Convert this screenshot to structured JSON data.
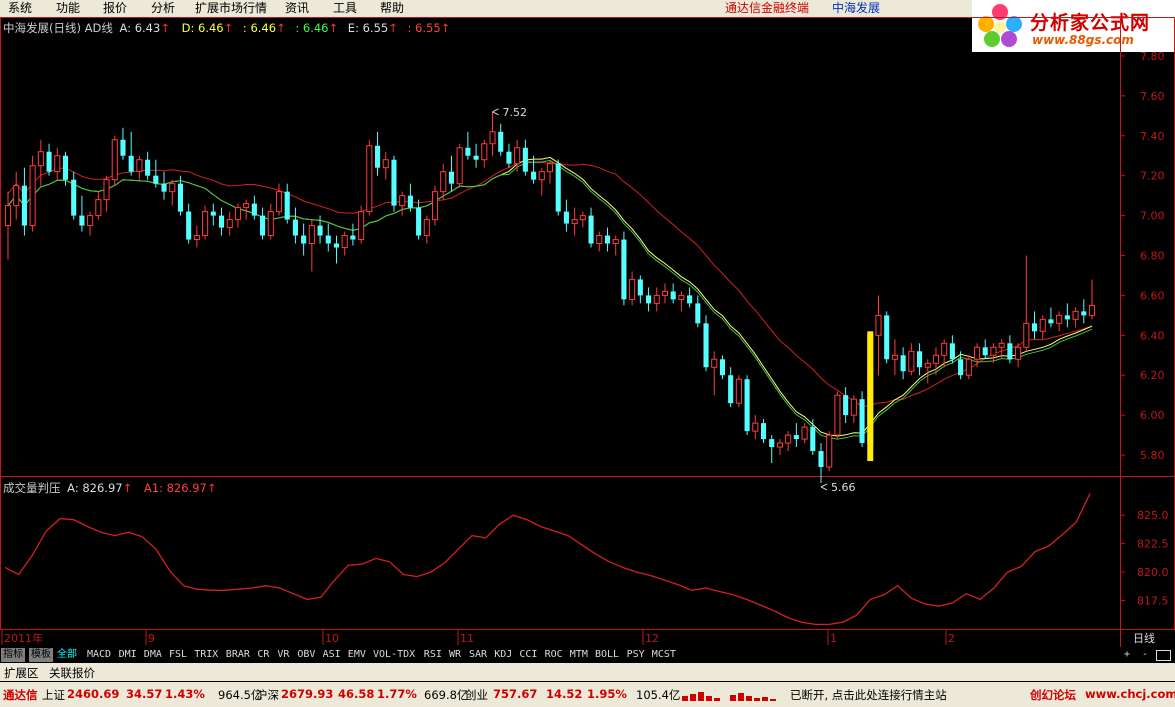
{
  "menu": [
    "系统",
    "功能",
    "报价",
    "分析",
    "扩展市场行情",
    "资讯",
    "工具",
    "帮助"
  ],
  "promo": "通达信金融终端",
  "stock_name": "中海发展",
  "logo": {
    "title": "分析家公式网",
    "url": "www.88gs.com"
  },
  "price_header": {
    "prefix": "中海发展(日线) AD线",
    "a": "A: 6.43",
    "d": "D: 6.46",
    "v3": ": 6.46",
    "v4": ": 6.46",
    "e": "E: 6.55",
    "v6": ": 6.55"
  },
  "ind_header": {
    "name": "成交量判压",
    "a": "A: 826.97",
    "a1": "A1: 826.97"
  },
  "chart_data": [
    {
      "type": "candlestick",
      "ylim": [
        5.7,
        7.9
      ],
      "yticks": [
        "7.80",
        "7.60",
        "7.40",
        "7.20",
        "7.00",
        "6.80",
        "6.60",
        "6.40",
        "6.20",
        "6.00",
        "5.80"
      ],
      "annotations": [
        "7.52",
        "5.66"
      ],
      "ohlc": [
        [
          6.95,
          7.12,
          6.78,
          7.05
        ],
        [
          7.05,
          7.22,
          6.98,
          7.15
        ],
        [
          7.15,
          7.24,
          6.9,
          6.95
        ],
        [
          6.95,
          7.3,
          6.92,
          7.25
        ],
        [
          7.25,
          7.38,
          7.15,
          7.32
        ],
        [
          7.32,
          7.36,
          7.2,
          7.22
        ],
        [
          7.22,
          7.34,
          7.18,
          7.3
        ],
        [
          7.3,
          7.32,
          7.15,
          7.18
        ],
        [
          7.18,
          7.22,
          6.98,
          7.0
        ],
        [
          7.0,
          7.1,
          6.92,
          6.95
        ],
        [
          6.95,
          7.02,
          6.9,
          7.0
        ],
        [
          7.0,
          7.12,
          6.98,
          7.08
        ],
        [
          7.08,
          7.2,
          7.02,
          7.18
        ],
        [
          7.18,
          7.4,
          7.15,
          7.38
        ],
        [
          7.38,
          7.44,
          7.28,
          7.3
        ],
        [
          7.3,
          7.42,
          7.2,
          7.22
        ],
        [
          7.22,
          7.3,
          7.18,
          7.28
        ],
        [
          7.28,
          7.32,
          7.18,
          7.2
        ],
        [
          7.2,
          7.28,
          7.14,
          7.16
        ],
        [
          7.16,
          7.22,
          7.08,
          7.12
        ],
        [
          7.12,
          7.18,
          7.05,
          7.16
        ],
        [
          7.16,
          7.2,
          7.0,
          7.02
        ],
        [
          7.02,
          7.06,
          6.86,
          6.88
        ],
        [
          6.88,
          6.95,
          6.84,
          6.9
        ],
        [
          6.9,
          7.05,
          6.88,
          7.02
        ],
        [
          7.02,
          7.06,
          6.95,
          7.0
        ],
        [
          7.0,
          7.04,
          6.9,
          6.94
        ],
        [
          6.94,
          7.02,
          6.9,
          6.98
        ],
        [
          6.98,
          7.06,
          6.94,
          7.04
        ],
        [
          7.04,
          7.08,
          6.98,
          7.06
        ],
        [
          7.06,
          7.1,
          6.98,
          7.0
        ],
        [
          7.0,
          7.04,
          6.88,
          6.9
        ],
        [
          6.9,
          7.06,
          6.88,
          7.02
        ],
        [
          7.02,
          7.16,
          7.0,
          7.12
        ],
        [
          7.12,
          7.16,
          6.96,
          6.98
        ],
        [
          6.98,
          7.04,
          6.86,
          6.9
        ],
        [
          6.9,
          6.96,
          6.8,
          6.86
        ],
        [
          6.86,
          6.98,
          6.72,
          6.95
        ],
        [
          6.95,
          7.0,
          6.86,
          6.9
        ],
        [
          6.9,
          6.96,
          6.82,
          6.86
        ],
        [
          6.86,
          6.9,
          6.76,
          6.84
        ],
        [
          6.84,
          6.92,
          6.8,
          6.9
        ],
        [
          6.9,
          6.96,
          6.85,
          6.88
        ],
        [
          6.88,
          7.05,
          6.86,
          7.02
        ],
        [
          7.02,
          7.38,
          7.0,
          7.35
        ],
        [
          7.35,
          7.42,
          7.2,
          7.24
        ],
        [
          7.24,
          7.32,
          7.18,
          7.28
        ],
        [
          7.28,
          7.3,
          7.02,
          7.05
        ],
        [
          7.05,
          7.12,
          7.0,
          7.1
        ],
        [
          7.1,
          7.16,
          7.02,
          7.04
        ],
        [
          7.04,
          7.08,
          6.88,
          6.9
        ],
        [
          6.9,
          7.0,
          6.86,
          6.98
        ],
        [
          6.98,
          7.15,
          6.95,
          7.12
        ],
        [
          7.12,
          7.26,
          7.08,
          7.22
        ],
        [
          7.22,
          7.3,
          7.12,
          7.16
        ],
        [
          7.16,
          7.36,
          7.14,
          7.34
        ],
        [
          7.34,
          7.42,
          7.28,
          7.3
        ],
        [
          7.3,
          7.36,
          7.24,
          7.28
        ],
        [
          7.28,
          7.38,
          7.24,
          7.36
        ],
        [
          7.36,
          7.52,
          7.3,
          7.42
        ],
        [
          7.42,
          7.46,
          7.3,
          7.32
        ],
        [
          7.32,
          7.36,
          7.24,
          7.26
        ],
        [
          7.26,
          7.38,
          7.22,
          7.34
        ],
        [
          7.34,
          7.38,
          7.2,
          7.22
        ],
        [
          7.22,
          7.3,
          7.16,
          7.18
        ],
        [
          7.18,
          7.24,
          7.1,
          7.22
        ],
        [
          7.22,
          7.28,
          7.16,
          7.26
        ],
        [
          7.26,
          7.28,
          7.0,
          7.02
        ],
        [
          7.02,
          7.08,
          6.92,
          6.96
        ],
        [
          6.96,
          7.04,
          6.9,
          6.98
        ],
        [
          6.98,
          7.02,
          6.94,
          7.0
        ],
        [
          7.0,
          7.04,
          6.84,
          6.86
        ],
        [
          6.86,
          6.92,
          6.82,
          6.9
        ],
        [
          6.9,
          6.94,
          6.82,
          6.86
        ],
        [
          6.86,
          6.9,
          6.8,
          6.88
        ],
        [
          6.88,
          6.92,
          6.55,
          6.58
        ],
        [
          6.58,
          6.72,
          6.55,
          6.68
        ],
        [
          6.68,
          6.7,
          6.56,
          6.6
        ],
        [
          6.6,
          6.64,
          6.52,
          6.56
        ],
        [
          6.56,
          6.64,
          6.52,
          6.6
        ],
        [
          6.6,
          6.66,
          6.56,
          6.62
        ],
        [
          6.62,
          6.66,
          6.56,
          6.58
        ],
        [
          6.58,
          6.62,
          6.52,
          6.6
        ],
        [
          6.6,
          6.64,
          6.54,
          6.56
        ],
        [
          6.56,
          6.6,
          6.44,
          6.46
        ],
        [
          6.46,
          6.5,
          6.22,
          6.24
        ],
        [
          6.24,
          6.32,
          6.1,
          6.28
        ],
        [
          6.28,
          6.3,
          6.18,
          6.2
        ],
        [
          6.2,
          6.24,
          6.04,
          6.06
        ],
        [
          6.06,
          6.2,
          6.04,
          6.18
        ],
        [
          6.18,
          6.2,
          5.9,
          5.92
        ],
        [
          5.92,
          6.0,
          5.88,
          5.96
        ],
        [
          5.96,
          5.98,
          5.86,
          5.88
        ],
        [
          5.88,
          5.9,
          5.76,
          5.84
        ],
        [
          5.84,
          5.88,
          5.8,
          5.86
        ],
        [
          5.86,
          5.92,
          5.82,
          5.9
        ],
        [
          5.9,
          5.96,
          5.84,
          5.88
        ],
        [
          5.88,
          5.96,
          5.86,
          5.94
        ],
        [
          5.94,
          5.98,
          5.8,
          5.82
        ],
        [
          5.82,
          5.86,
          5.66,
          5.74
        ],
        [
          5.74,
          5.92,
          5.72,
          5.9
        ],
        [
          5.9,
          6.12,
          5.88,
          6.1
        ],
        [
          6.1,
          6.14,
          5.96,
          6.0
        ],
        [
          6.0,
          6.1,
          5.96,
          6.08
        ],
        [
          6.08,
          6.12,
          5.84,
          5.86
        ],
        [
          5.86,
          6.42,
          5.78,
          6.4
        ],
        [
          6.4,
          6.6,
          6.2,
          6.5
        ],
        [
          6.5,
          6.52,
          6.26,
          6.28
        ],
        [
          6.28,
          6.38,
          6.2,
          6.3
        ],
        [
          6.3,
          6.34,
          6.18,
          6.22
        ],
        [
          6.22,
          6.36,
          6.2,
          6.32
        ],
        [
          6.32,
          6.36,
          6.2,
          6.24
        ],
        [
          6.24,
          6.28,
          6.16,
          6.26
        ],
        [
          6.26,
          6.34,
          6.2,
          6.3
        ],
        [
          6.3,
          6.38,
          6.24,
          6.36
        ],
        [
          6.36,
          6.4,
          6.26,
          6.28
        ],
        [
          6.28,
          6.32,
          6.18,
          6.2
        ],
        [
          6.2,
          6.3,
          6.18,
          6.28
        ],
        [
          6.28,
          6.36,
          6.24,
          6.34
        ],
        [
          6.34,
          6.38,
          6.28,
          6.3
        ],
        [
          6.3,
          6.36,
          6.26,
          6.34
        ],
        [
          6.34,
          6.38,
          6.28,
          6.36
        ],
        [
          6.36,
          6.4,
          6.26,
          6.28
        ],
        [
          6.28,
          6.36,
          6.24,
          6.34
        ],
        [
          6.34,
          6.8,
          6.32,
          6.46
        ],
        [
          6.46,
          6.52,
          6.38,
          6.42
        ],
        [
          6.42,
          6.5,
          6.38,
          6.48
        ],
        [
          6.48,
          6.54,
          6.44,
          6.46
        ],
        [
          6.46,
          6.52,
          6.42,
          6.5
        ],
        [
          6.5,
          6.56,
          6.44,
          6.48
        ],
        [
          6.48,
          6.54,
          6.44,
          6.52
        ],
        [
          6.52,
          6.58,
          6.46,
          6.5
        ],
        [
          6.5,
          6.68,
          6.48,
          6.55
        ]
      ]
    },
    {
      "type": "line",
      "ylim": [
        815,
        828
      ],
      "yticks": [
        "825.0",
        "822.5",
        "820.0",
        "817.5"
      ],
      "values": [
        820.4,
        819.8,
        821.5,
        823.6,
        824.7,
        824.6,
        824.0,
        823.5,
        823.2,
        823.5,
        823.1,
        822.0,
        820.1,
        818.8,
        818.5,
        818.4,
        818.4,
        818.5,
        818.6,
        818.8,
        818.6,
        818.1,
        817.6,
        817.8,
        819.3,
        820.6,
        820.7,
        821.2,
        820.9,
        819.8,
        819.6,
        820.0,
        820.8,
        822.0,
        823.2,
        823.0,
        824.2,
        825.0,
        824.6,
        824.0,
        823.6,
        823.2,
        822.4,
        821.6,
        820.9,
        820.4,
        820.0,
        819.7,
        819.3,
        818.9,
        818.4,
        818.6,
        818.3,
        818.0,
        817.6,
        817.1,
        816.6,
        816.0,
        815.6,
        815.4,
        815.4,
        815.6,
        816.2,
        817.6,
        818.0,
        818.8,
        817.7,
        817.2,
        817.0,
        817.3,
        818.1,
        817.6,
        818.6,
        820.0,
        820.5,
        821.8,
        822.3,
        823.3,
        824.4,
        826.9
      ],
      "xticks": [
        "2011年",
        "9",
        "10",
        "11",
        "12",
        "1",
        "2"
      ],
      "period": "日线"
    }
  ],
  "tabs": [
    "指标",
    "模板",
    "全部",
    "MACD",
    "DMI",
    "DMA",
    "FSL",
    "TRIX",
    "BRAR",
    "CR",
    "VR",
    "OBV",
    "ASI",
    "EMV",
    "VOL-TDX",
    "RSI",
    "WR",
    "SAR",
    "KDJ",
    "CCI",
    "ROC",
    "MTM",
    "BOLL",
    "PSY",
    "MCST"
  ],
  "tab_controls": [
    "+",
    "-"
  ],
  "ext_tabs": [
    "扩展区",
    "关联报价"
  ],
  "status": {
    "brand": "通达信",
    "sh_label": "上证",
    "sh_val": "2460.69",
    "sh_chg": "34.57",
    "sh_pct": "1.43%",
    "sh_amt": "964.5亿",
    "hs_label": "沪深",
    "hs_val": "2679.93",
    "hs_chg": "46.58",
    "hs_pct": "1.77%",
    "hs_amt": "669.8亿",
    "cy_label": "创业",
    "cy_val": "757.67",
    "cy_chg": "14.52",
    "cy_pct": "1.95%",
    "cy_amt": "105.4亿",
    "msg": "已断开, 点击此处连接行情主站",
    "forum": "创幻论坛",
    "site": "www.chcj.com"
  }
}
